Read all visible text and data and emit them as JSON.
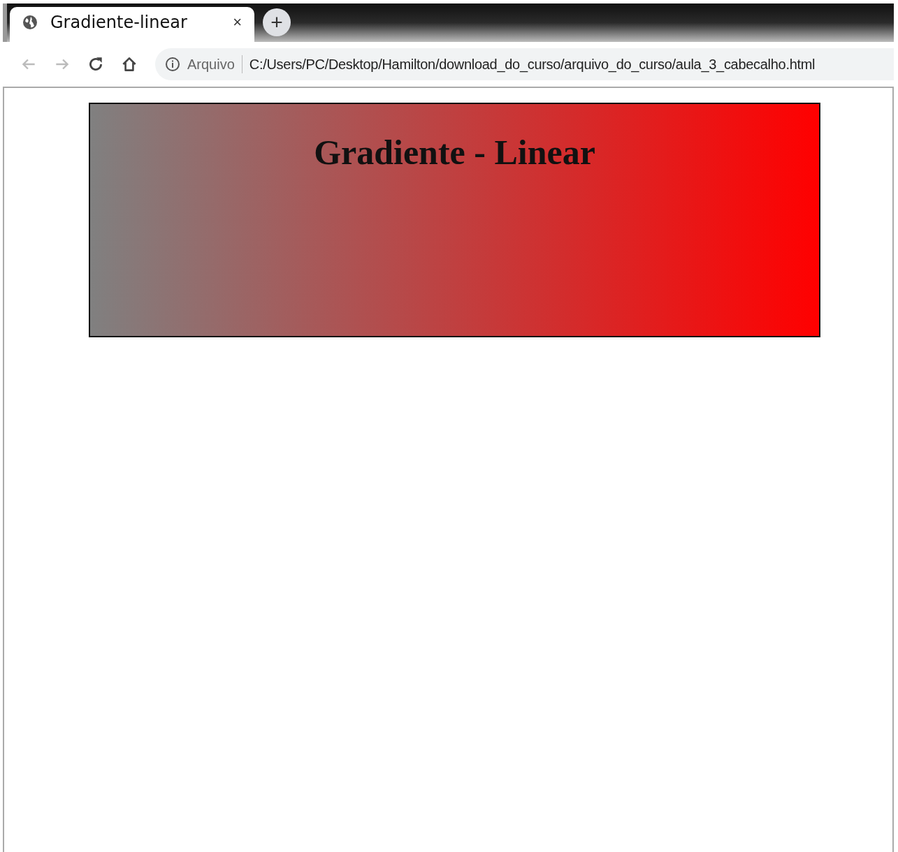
{
  "tabs": [
    {
      "title": "Gradiente-linear",
      "close": "×",
      "selected": true
    }
  ],
  "new_tab": "+",
  "nav_buttons": [
    {
      "kind": "back",
      "disabled": true
    },
    {
      "kind": "forward",
      "disabled": true
    },
    {
      "kind": "reload",
      "disabled": false
    },
    {
      "kind": "home",
      "disabled": false
    }
  ],
  "address_bar": {
    "security_label": "Arquivo",
    "url": "C:/Users/PC/Desktop/Hamilton/download_do_curso/arquivo_do_curso/aula_3_cabecalho.html"
  },
  "page": {
    "header": {
      "title": "Gradiente - Linear"
    }
  }
}
